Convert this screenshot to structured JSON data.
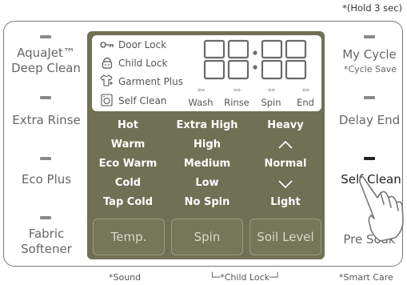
{
  "hold_note": "*(Hold 3 sec)",
  "left": {
    "aquajet_line1": "AquaJet™",
    "aquajet_line2": "Deep Clean",
    "extra_rinse": "Extra Rinse",
    "eco_plus": "Eco Plus",
    "fabric_line1": "Fabric",
    "fabric_line2": "Softener"
  },
  "right": {
    "my_cycle": "My Cycle",
    "cycle_save": "*Cycle Save",
    "delay_end": "Delay End",
    "self_clean": "Self Clean",
    "pre_soak": "Pre Soak"
  },
  "lcd": {
    "door_lock": "Door Lock",
    "child_lock": "Child Lock",
    "garment_plus": "Garment Plus",
    "self_clean": "Self Clean",
    "digits": "88:88",
    "stages": [
      "Wash",
      "Rinse",
      "Spin",
      "End"
    ],
    "stage_chevrons": "»»"
  },
  "temp_options": [
    "Hot",
    "Warm",
    "Eco Warm",
    "Cold",
    "Tap Cold"
  ],
  "spin_options": [
    "Extra High",
    "High",
    "Medium",
    "Low",
    "No Spin"
  ],
  "soil_options": [
    "Heavy",
    "^",
    "Normal",
    "v",
    "Light"
  ],
  "buttons": {
    "temp": "Temp.",
    "spin": "Spin",
    "soil": "Soil Level"
  },
  "footer": {
    "sound": "*Sound",
    "child_lock": "*Child Lock",
    "smart_care": "*Smart Care"
  }
}
